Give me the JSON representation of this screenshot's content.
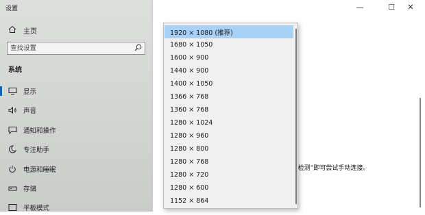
{
  "window": {
    "title": "设置",
    "minimize_glyph": "—",
    "maximize_glyph": "☐",
    "close_glyph": "✕"
  },
  "sidebar": {
    "home_label": "主页",
    "search_placeholder": "查找设置",
    "section_title": "系统",
    "items": [
      {
        "label": "显示",
        "icon": "monitor-icon",
        "active": true
      },
      {
        "label": "声音",
        "icon": "speaker-icon"
      },
      {
        "label": "通知和操作",
        "icon": "notification-icon"
      },
      {
        "label": "专注助手",
        "icon": "moon-icon"
      },
      {
        "label": "电源和睡眠",
        "icon": "power-icon"
      },
      {
        "label": "存储",
        "icon": "storage-icon"
      },
      {
        "label": "平板模式",
        "icon": "tablet-icon"
      }
    ]
  },
  "content": {
    "partial_text": "“检测”即可尝试手动连接。"
  },
  "resolution_dropdown": {
    "selected": "1920 × 1080 (推荐)",
    "options": [
      "1920 × 1080 (推荐)",
      "1680 × 1050",
      "1600 × 900",
      "1440 × 900",
      "1400 × 1050",
      "1366 × 768",
      "1360 × 768",
      "1280 × 1024",
      "1280 × 960",
      "1280 × 800",
      "1280 × 768",
      "1280 × 720",
      "1280 × 600",
      "1152 × 864"
    ]
  },
  "colors": {
    "accent": "#0067c0",
    "selected_bg": "#a9d0f5",
    "sidebar_bg": "#d7d9d6"
  }
}
